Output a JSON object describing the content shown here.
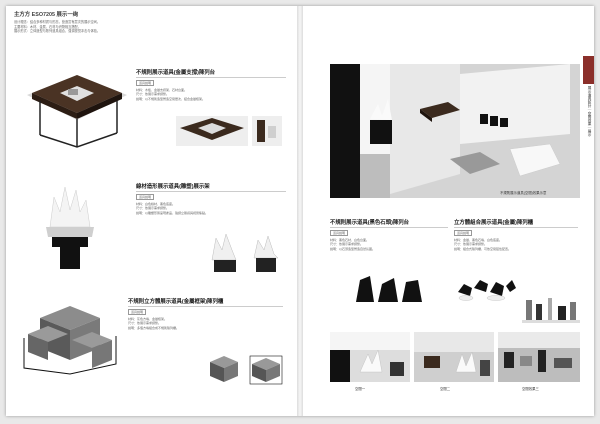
{
  "header": {
    "title": "主方方    ESO7205    展示一绚",
    "lines": [
      "设计理念：结合多种材质与形态，营造富有层次的展示空间。",
      "主要材料：木材、金属、石材与织物相互搭配。",
      "展示形式：立体造型与陈列道具组合，强调视觉冲击与体验。"
    ]
  },
  "left_sections": [
    {
      "title": "不規則展示道具(金屬支撐)陳列台",
      "sub": "道具說明",
      "text": [
        "材料：木板、金屬支撐架、石材台面。",
        "尺寸：依展示需求調整。",
        "說明：以不規則造型營造空間層次，結合金屬框架。"
      ]
    },
    {
      "title": "線材造形展示道具(雕塑)展示架",
      "sub": "道具說明",
      "text": [
        "材料：白色線材、黑色底座。",
        "尺寸：依展示需求調整。",
        "說明：以雕塑形態呈現產品，強調立體感與視覺焦點。"
      ]
    },
    {
      "title": "不規則立方體展示道具(金屬框架)陳列櫃",
      "sub": "道具說明",
      "text": [
        "材料：灰色方塊、金屬框架。",
        "尺寸：依展示需求調整。",
        "說明：多個方塊組合成不規則陳列櫃。"
      ]
    }
  ],
  "right": {
    "hero_caption": "不規則展示道具(空間)效果示意",
    "sections": [
      {
        "title": "不規則展示道具(黑色石頭)陳列台",
        "sub": "道具說明",
        "text": [
          "材料：黑色石材、白色台面。",
          "尺寸：依展示需求調整。",
          "說明：以石頭造型營造自然氛圍。"
        ]
      },
      {
        "title": "立方體組合展示道具(金屬)陳列櫃",
        "sub": "道具說明",
        "text": [
          "材料：金屬、黑色石塊、白色底座。",
          "尺寸：依展示需求調整。",
          "說明：組合式陳列櫃，可依空間彈性配置。"
        ]
      }
    ],
    "bottom_captions": [
      "空間一",
      "空間二",
      "空間效果三"
    ]
  },
  "sidetab": {
    "label": "展示道具設計｜空間效果｜展示"
  }
}
